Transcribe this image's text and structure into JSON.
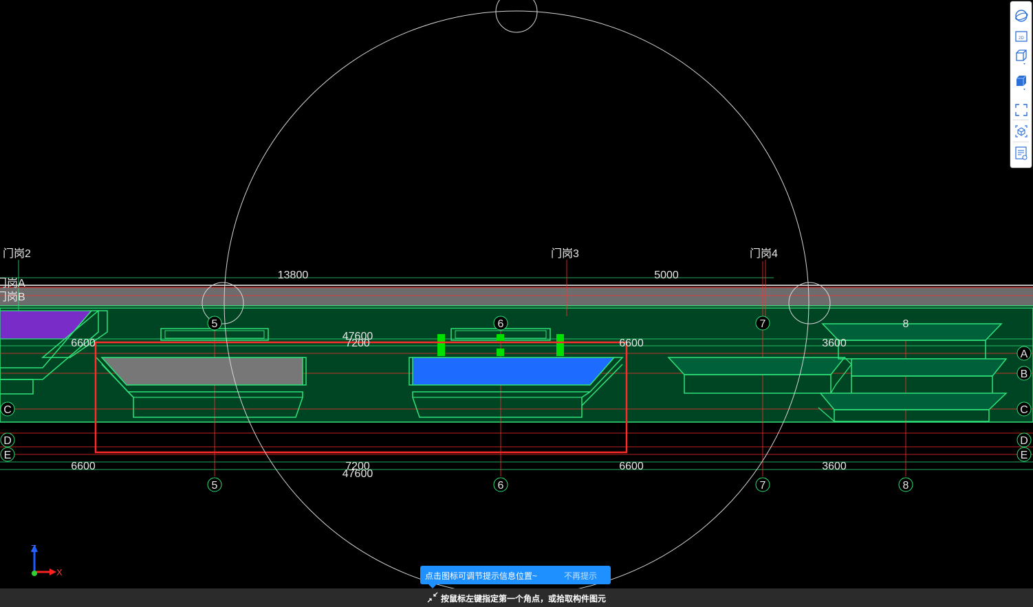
{
  "axis_labels": {
    "gate2": "门岗2",
    "gate3": "门岗3",
    "gate4": "门岗4",
    "gateA": "门岗A",
    "gateB": "门岗B"
  },
  "dimensions": {
    "top_13800": "13800",
    "top_5000": "5000",
    "total_top": "47600",
    "total_bottom": "47600",
    "d6600_left_top": "6600",
    "d7200_top": "7200",
    "d6600_right_top": "6600",
    "d3600_top": "3600",
    "d6600_left_bottom": "6600",
    "d7200_bottom": "7200",
    "d6600_right_bottom": "6600",
    "d3600_bottom": "3600"
  },
  "grid_bubbles": {
    "v5": "5",
    "v6": "6",
    "v7": "7",
    "v8": "8",
    "hA": "A",
    "hB": "B",
    "hC": "C",
    "hD": "D",
    "hE": "E"
  },
  "axes_indicator": {
    "z": "Z",
    "x": "X"
  },
  "toolbar": {
    "icons": [
      "orbit-icon",
      "2d-view-icon",
      "3d-view-icon",
      "shaded-cube-icon",
      "fullscreen-icon",
      "component-view-icon",
      "properties-list-icon"
    ]
  },
  "tooltip": {
    "message": "点击图标可调节提示信息位置~",
    "dismiss": "不再提示"
  },
  "status": {
    "prompt": "按鼠标左键指定第一个角点，或拾取构件图元"
  },
  "colors": {
    "background": "#000000",
    "slab": "#004523",
    "outline": "#2fe37a",
    "selection": "#ff2a2a",
    "blue_fill": "#1e6bff",
    "purple_fill": "#7a2cc9",
    "grey_fill": "#777777",
    "tip": "#1e90ff"
  }
}
